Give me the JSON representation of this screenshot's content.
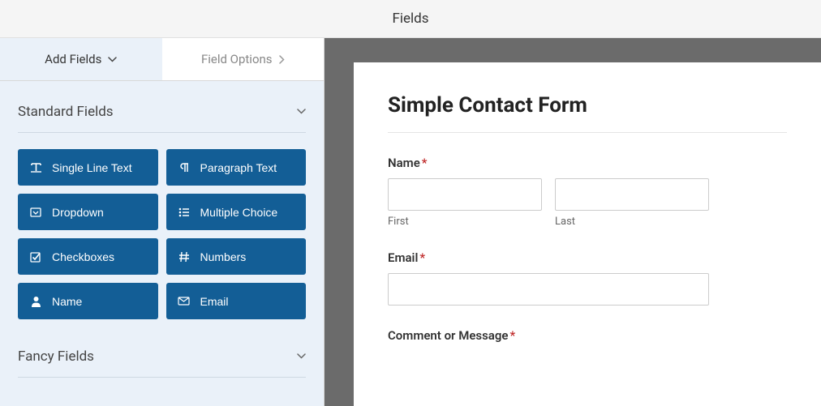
{
  "header": {
    "title": "Fields"
  },
  "tabs": {
    "add": "Add Fields",
    "options": "Field Options"
  },
  "sections": {
    "standard": {
      "title": "Standard Fields",
      "fields": {
        "single_line_text": "Single Line Text",
        "paragraph_text": "Paragraph Text",
        "dropdown": "Dropdown",
        "multiple_choice": "Multiple Choice",
        "checkboxes": "Checkboxes",
        "numbers": "Numbers",
        "name": "Name",
        "email": "Email"
      }
    },
    "fancy": {
      "title": "Fancy Fields"
    }
  },
  "form": {
    "title": "Simple Contact Form",
    "name": {
      "label": "Name",
      "first": "First",
      "last": "Last"
    },
    "email": {
      "label": "Email"
    },
    "comment": {
      "label": "Comment or Message"
    }
  }
}
